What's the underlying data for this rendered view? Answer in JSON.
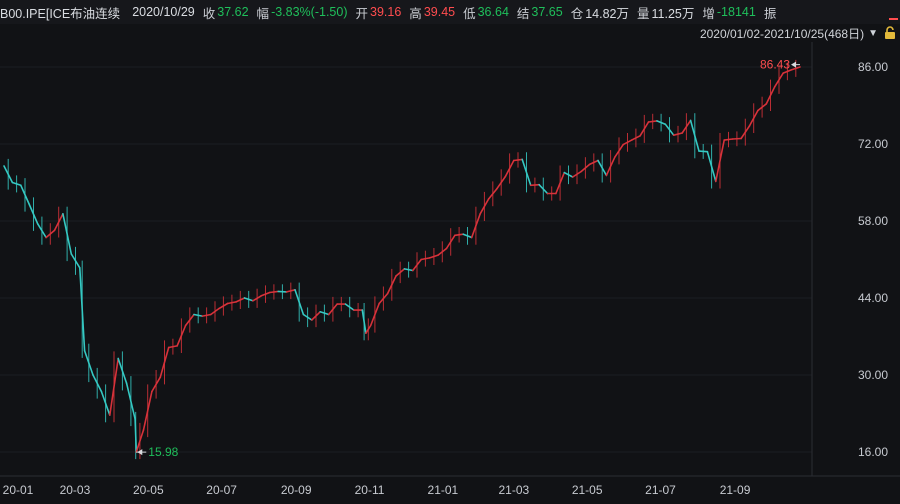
{
  "header": {
    "symbol": "B00.IPE[ICE布油连续",
    "date": "2020/10/29",
    "close_label": "收",
    "close_value": "37.62",
    "change_label": "幅",
    "change_value": "-3.83%(-1.50)",
    "open_label": "开",
    "open_value": "39.16",
    "high_label": "高",
    "high_value": "39.45",
    "low_label": "低",
    "low_value": "36.64",
    "settle_label": "结",
    "settle_value": "37.65",
    "oi_label": "仓",
    "oi_value": "14.82万",
    "volume_label": "量",
    "volume_value": "11.25万",
    "increase_label": "增",
    "increase_value": "-18141",
    "amplitude_label": "振"
  },
  "range": {
    "text": "2020/01/02-2021/10/25(468日)"
  },
  "colors": {
    "up": "#ff4d4f",
    "down": "#1fbf5b",
    "up_candle": "#d8323a",
    "down_candle": "#35c9c3",
    "background": "#111215"
  },
  "chart_data": {
    "type": "line",
    "title": "",
    "ylim": [
      16,
      86
    ],
    "y_ticks": [
      "86.00",
      "72.00",
      "58.00",
      "44.00",
      "30.00",
      "16.00"
    ],
    "x_ticks": [
      "20-01",
      "20-03",
      "20-05",
      "20-07",
      "20-09",
      "20-11",
      "21-01",
      "21-03",
      "21-05",
      "21-07",
      "21-09"
    ],
    "annotations": {
      "max": "86.43",
      "min": "15.98"
    },
    "series": [
      {
        "points": [
          [
            "2020-01-02",
            68
          ],
          [
            "2020-01-09",
            65
          ],
          [
            "2020-01-16",
            64.5
          ],
          [
            "2020-01-23",
            61
          ],
          [
            "2020-01-30",
            57.5
          ],
          [
            "2020-02-06",
            55
          ],
          [
            "2020-02-13",
            56.3
          ],
          [
            "2020-02-20",
            59.3
          ],
          [
            "2020-02-27",
            52
          ],
          [
            "2020-03-05",
            49.5
          ],
          [
            "2020-03-09",
            34.4
          ],
          [
            "2020-03-16",
            30
          ],
          [
            "2020-03-23",
            27
          ],
          [
            "2020-03-30",
            22.7
          ],
          [
            "2020-04-06",
            33
          ],
          [
            "2020-04-13",
            28.5
          ],
          [
            "2020-04-20",
            22
          ],
          [
            "2020-04-21",
            16
          ],
          [
            "2020-04-27",
            20
          ],
          [
            "2020-05-04",
            27
          ],
          [
            "2020-05-11",
            29.6
          ],
          [
            "2020-05-18",
            35
          ],
          [
            "2020-05-25",
            35.3
          ],
          [
            "2020-06-01",
            39
          ],
          [
            "2020-06-08",
            41
          ],
          [
            "2020-06-15",
            40.7
          ],
          [
            "2020-06-22",
            41
          ],
          [
            "2020-06-29",
            42.1
          ],
          [
            "2020-07-06",
            43
          ],
          [
            "2020-07-13",
            43.3
          ],
          [
            "2020-07-20",
            44
          ],
          [
            "2020-07-27",
            43.5
          ],
          [
            "2020-08-03",
            44.4
          ],
          [
            "2020-08-10",
            45
          ],
          [
            "2020-08-17",
            45.2
          ],
          [
            "2020-08-24",
            45.1
          ],
          [
            "2020-08-31",
            45.5
          ],
          [
            "2020-09-07",
            41
          ],
          [
            "2020-09-14",
            40
          ],
          [
            "2020-09-21",
            41.5
          ],
          [
            "2020-09-28",
            41
          ],
          [
            "2020-10-05",
            42.9
          ],
          [
            "2020-10-12",
            42.9
          ],
          [
            "2020-10-19",
            41.8
          ],
          [
            "2020-10-26",
            41.8
          ],
          [
            "2020-10-29",
            37.6
          ],
          [
            "2020-11-02",
            39
          ],
          [
            "2020-11-09",
            43
          ],
          [
            "2020-11-16",
            44.8
          ],
          [
            "2020-11-23",
            48
          ],
          [
            "2020-11-30",
            49.3
          ],
          [
            "2020-12-07",
            49
          ],
          [
            "2020-12-14",
            51
          ],
          [
            "2020-12-21",
            51.3
          ],
          [
            "2020-12-28",
            51.8
          ],
          [
            "2021-01-04",
            53
          ],
          [
            "2021-01-11",
            55.4
          ],
          [
            "2021-01-18",
            55.6
          ],
          [
            "2021-01-25",
            55
          ],
          [
            "2021-02-01",
            59.3
          ],
          [
            "2021-02-08",
            62
          ],
          [
            "2021-02-15",
            63.9
          ],
          [
            "2021-02-22",
            66.1
          ],
          [
            "2021-03-01",
            69
          ],
          [
            "2021-03-08",
            69.2
          ],
          [
            "2021-03-15",
            64.5
          ],
          [
            "2021-03-22",
            64.6
          ],
          [
            "2021-03-29",
            63
          ],
          [
            "2021-04-05",
            63
          ],
          [
            "2021-04-12",
            66.8
          ],
          [
            "2021-04-19",
            66
          ],
          [
            "2021-04-26",
            67
          ],
          [
            "2021-05-03",
            68.3
          ],
          [
            "2021-05-10",
            69
          ],
          [
            "2021-05-17",
            66.3
          ],
          [
            "2021-05-24",
            69.6
          ],
          [
            "2021-05-31",
            71.9
          ],
          [
            "2021-06-07",
            72.7
          ],
          [
            "2021-06-14",
            73.5
          ],
          [
            "2021-06-21",
            76
          ],
          [
            "2021-06-28",
            76.2
          ],
          [
            "2021-07-05",
            75.6
          ],
          [
            "2021-07-12",
            73.6
          ],
          [
            "2021-07-19",
            74
          ],
          [
            "2021-07-26",
            76.3
          ],
          [
            "2021-08-02",
            70.7
          ],
          [
            "2021-08-09",
            70.6
          ],
          [
            "2021-08-16",
            65.2
          ],
          [
            "2021-08-23",
            72.7
          ],
          [
            "2021-08-30",
            72.9
          ],
          [
            "2021-09-06",
            73
          ],
          [
            "2021-09-13",
            75.3
          ],
          [
            "2021-09-20",
            78.1
          ],
          [
            "2021-09-27",
            79.3
          ],
          [
            "2021-10-04",
            82.4
          ],
          [
            "2021-10-11",
            84.9
          ],
          [
            "2021-10-18",
            85.5
          ],
          [
            "2021-10-25",
            86
          ]
        ]
      }
    ]
  }
}
